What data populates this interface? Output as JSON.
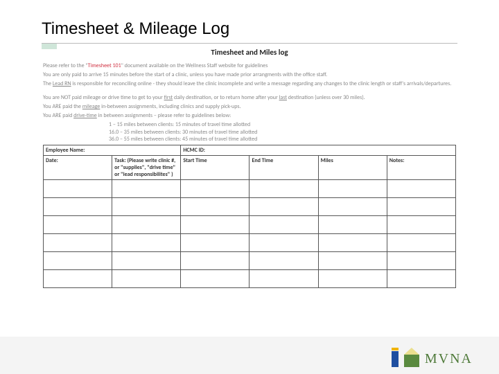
{
  "slide": {
    "title": "Timesheet & Mileage Log"
  },
  "doc": {
    "heading": "Timesheet and Miles log",
    "refer_pre": "Please refer to the \"",
    "refer_hl": "Timesheet 101",
    "refer_post": "\" document available on the Wellness Staff website for guidelines",
    "arrive": "You are only paid to arrive 15 minutes before the start of a clinic, unless you have made prior arrangments with the office staff.",
    "leadrn_pre": "The ",
    "leadrn_ul": "Lead RN",
    "leadrn_post": " is responsible for reconciling online - they should leave the clinic incomplete and write a message regarding any changes to the clinic length or staff's arrivals/departures.",
    "notpaid_a": "You are NOT paid mileage or drive time to get to your ",
    "notpaid_first": "first",
    "notpaid_b": " daily destination, or to return home after your ",
    "notpaid_last": "last",
    "notpaid_c": " destination (unless over 30 miles).",
    "arepaid_m_a": "You ARE paid the ",
    "arepaid_m_ul": "mileage",
    "arepaid_m_b": " in-between assignments, including clinics and supply pick-ups.",
    "arepaid_d_a": "You ARE paid ",
    "arepaid_d_ul": "drive-time",
    "arepaid_d_b": " in between assignments – please refer to guidelines below:",
    "allot1": "1   –   15  miles between clients:  15 minutes of travel time allotted",
    "allot2": "16.0   –   35  miles between clients:  30 minutes of travel time allotted",
    "allot3": "36.0   –   55  miles between clients:  45 minutes of travel time allotted",
    "emp_name_label": "Employee Name:",
    "hcmc_label": "HCMC ID:",
    "cols": {
      "date": "Date:",
      "task": "Task: (Please write clinic #, or \"supplies\", \"drive time\" or \"lead responsibilites\" )",
      "start": "Start Time",
      "end": "End Time",
      "miles": "Miles",
      "notes": "Notes:"
    }
  },
  "footer": {
    "org": "MVNA"
  }
}
